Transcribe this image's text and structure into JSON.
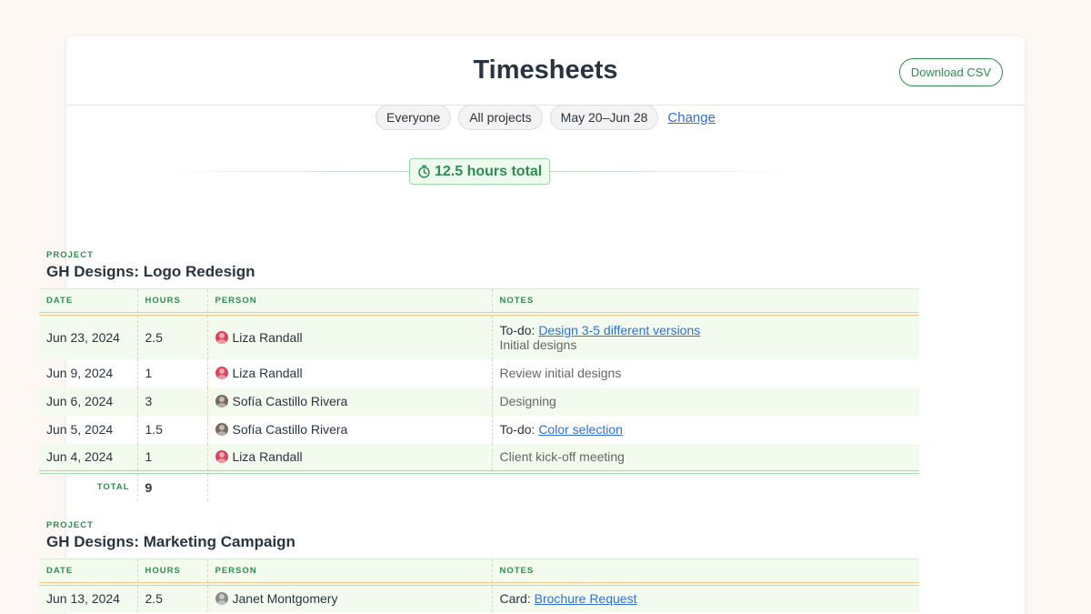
{
  "colors": {
    "accent": "#2f8c4f",
    "link": "#2f6fd6",
    "row_shade": "#f3faee",
    "bg": "#fdf8f3"
  },
  "header": {
    "title": "Timesheets",
    "download_label": "Download CSV"
  },
  "filters": {
    "people": "Everyone",
    "projects": "All projects",
    "dates": "May 20–Jun 28",
    "change_label": "Change"
  },
  "summary": {
    "icon": "stopwatch-icon",
    "total_label": "12.5 hours total"
  },
  "columns": {
    "date": "DATE",
    "hours": "HOURS",
    "person": "PERSON",
    "notes": "NOTES"
  },
  "projects": [
    {
      "kicker": "PROJECT",
      "title": "GH Designs: Logo Redesign",
      "total_label": "TOTAL",
      "total_value": "9",
      "rows": [
        {
          "date": "Jun 23, 2024",
          "hours": "2.5",
          "person": "Liza Randall",
          "avatar": "#d9455b",
          "note_prefix": "To-do:",
          "note_link": "Design 3-5 different versions",
          "note_text": "Initial designs"
        },
        {
          "date": "Jun 9, 2024",
          "hours": "1",
          "person": "Liza Randall",
          "avatar": "#d9455b",
          "note_text": "Review initial designs"
        },
        {
          "date": "Jun 6, 2024",
          "hours": "3",
          "person": "Sofía Castillo Rivera",
          "avatar": "#7a6a5c",
          "note_text": "Designing"
        },
        {
          "date": "Jun 5, 2024",
          "hours": "1.5",
          "person": "Sofía Castillo Rivera",
          "avatar": "#7a6a5c",
          "note_prefix": "To-do:",
          "note_link": "Color selection"
        },
        {
          "date": "Jun 4, 2024",
          "hours": "1",
          "person": "Liza Randall",
          "avatar": "#d9455b",
          "note_text": "Client kick-off meeting"
        }
      ]
    },
    {
      "kicker": "PROJECT",
      "title": "GH Designs: Marketing Campaign",
      "rows": [
        {
          "date": "Jun 13, 2024",
          "hours": "2.5",
          "person": "Janet Montgomery",
          "avatar": "#8c8a86",
          "note_prefix": "Card:",
          "note_link": "Brochure Request"
        }
      ]
    }
  ]
}
